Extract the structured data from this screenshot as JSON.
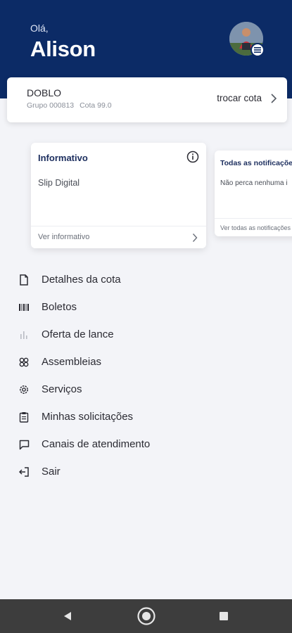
{
  "header": {
    "greeting": "Olá,",
    "user_name": "Alison",
    "avatar_icon": "user-photo",
    "menu_badge_icon": "menu-icon"
  },
  "quota": {
    "name": "DOBLO",
    "group": "Grupo 000813",
    "quota": "Cota 99.0",
    "swap_label": "trocar cota"
  },
  "cards": [
    {
      "title": "Informativo",
      "body": "Slip Digital",
      "footer": "Ver informativo"
    },
    {
      "title": "Todas as notificações",
      "body": "Não perca nenhuma i",
      "footer": "Ver todas as notificações"
    }
  ],
  "menu": [
    {
      "label": "Detalhes da cota",
      "icon": "document-icon"
    },
    {
      "label": "Boletos",
      "icon": "barcode-icon"
    },
    {
      "label": "Oferta de lance",
      "icon": "bar-chart-icon"
    },
    {
      "label": "Assembleias",
      "icon": "people-icon"
    },
    {
      "label": "Serviços",
      "icon": "gear-icon"
    },
    {
      "label": "Minhas solicitações",
      "icon": "clipboard-icon"
    },
    {
      "label": "Canais de atendimento",
      "icon": "chat-icon"
    },
    {
      "label": "Sair",
      "icon": "logout-icon"
    }
  ],
  "colors": {
    "header_bg": "#0c2b66",
    "accent_text": "#1c2e5e",
    "page_bg": "#f3f4f8"
  }
}
